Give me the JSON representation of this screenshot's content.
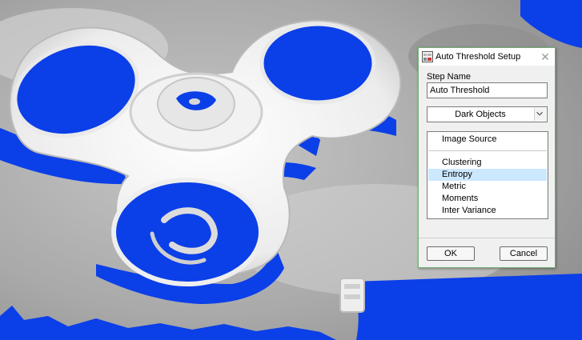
{
  "dialog": {
    "title": "Auto Threshold Setup",
    "step_name_label": "Step Name",
    "step_name_value": "Auto Threshold",
    "object_mode": "Dark Objects",
    "list_items": [
      "Image Source",
      "Clustering",
      "Entropy",
      "Metric",
      "Moments",
      "Inter Variance"
    ],
    "selected_item": "Entropy",
    "ok_label": "OK",
    "cancel_label": "Cancel"
  },
  "colors": {
    "overlay_blue": "#0b3fe8",
    "selection": "#cce8ff",
    "dialog_border": "#6fb06f"
  }
}
